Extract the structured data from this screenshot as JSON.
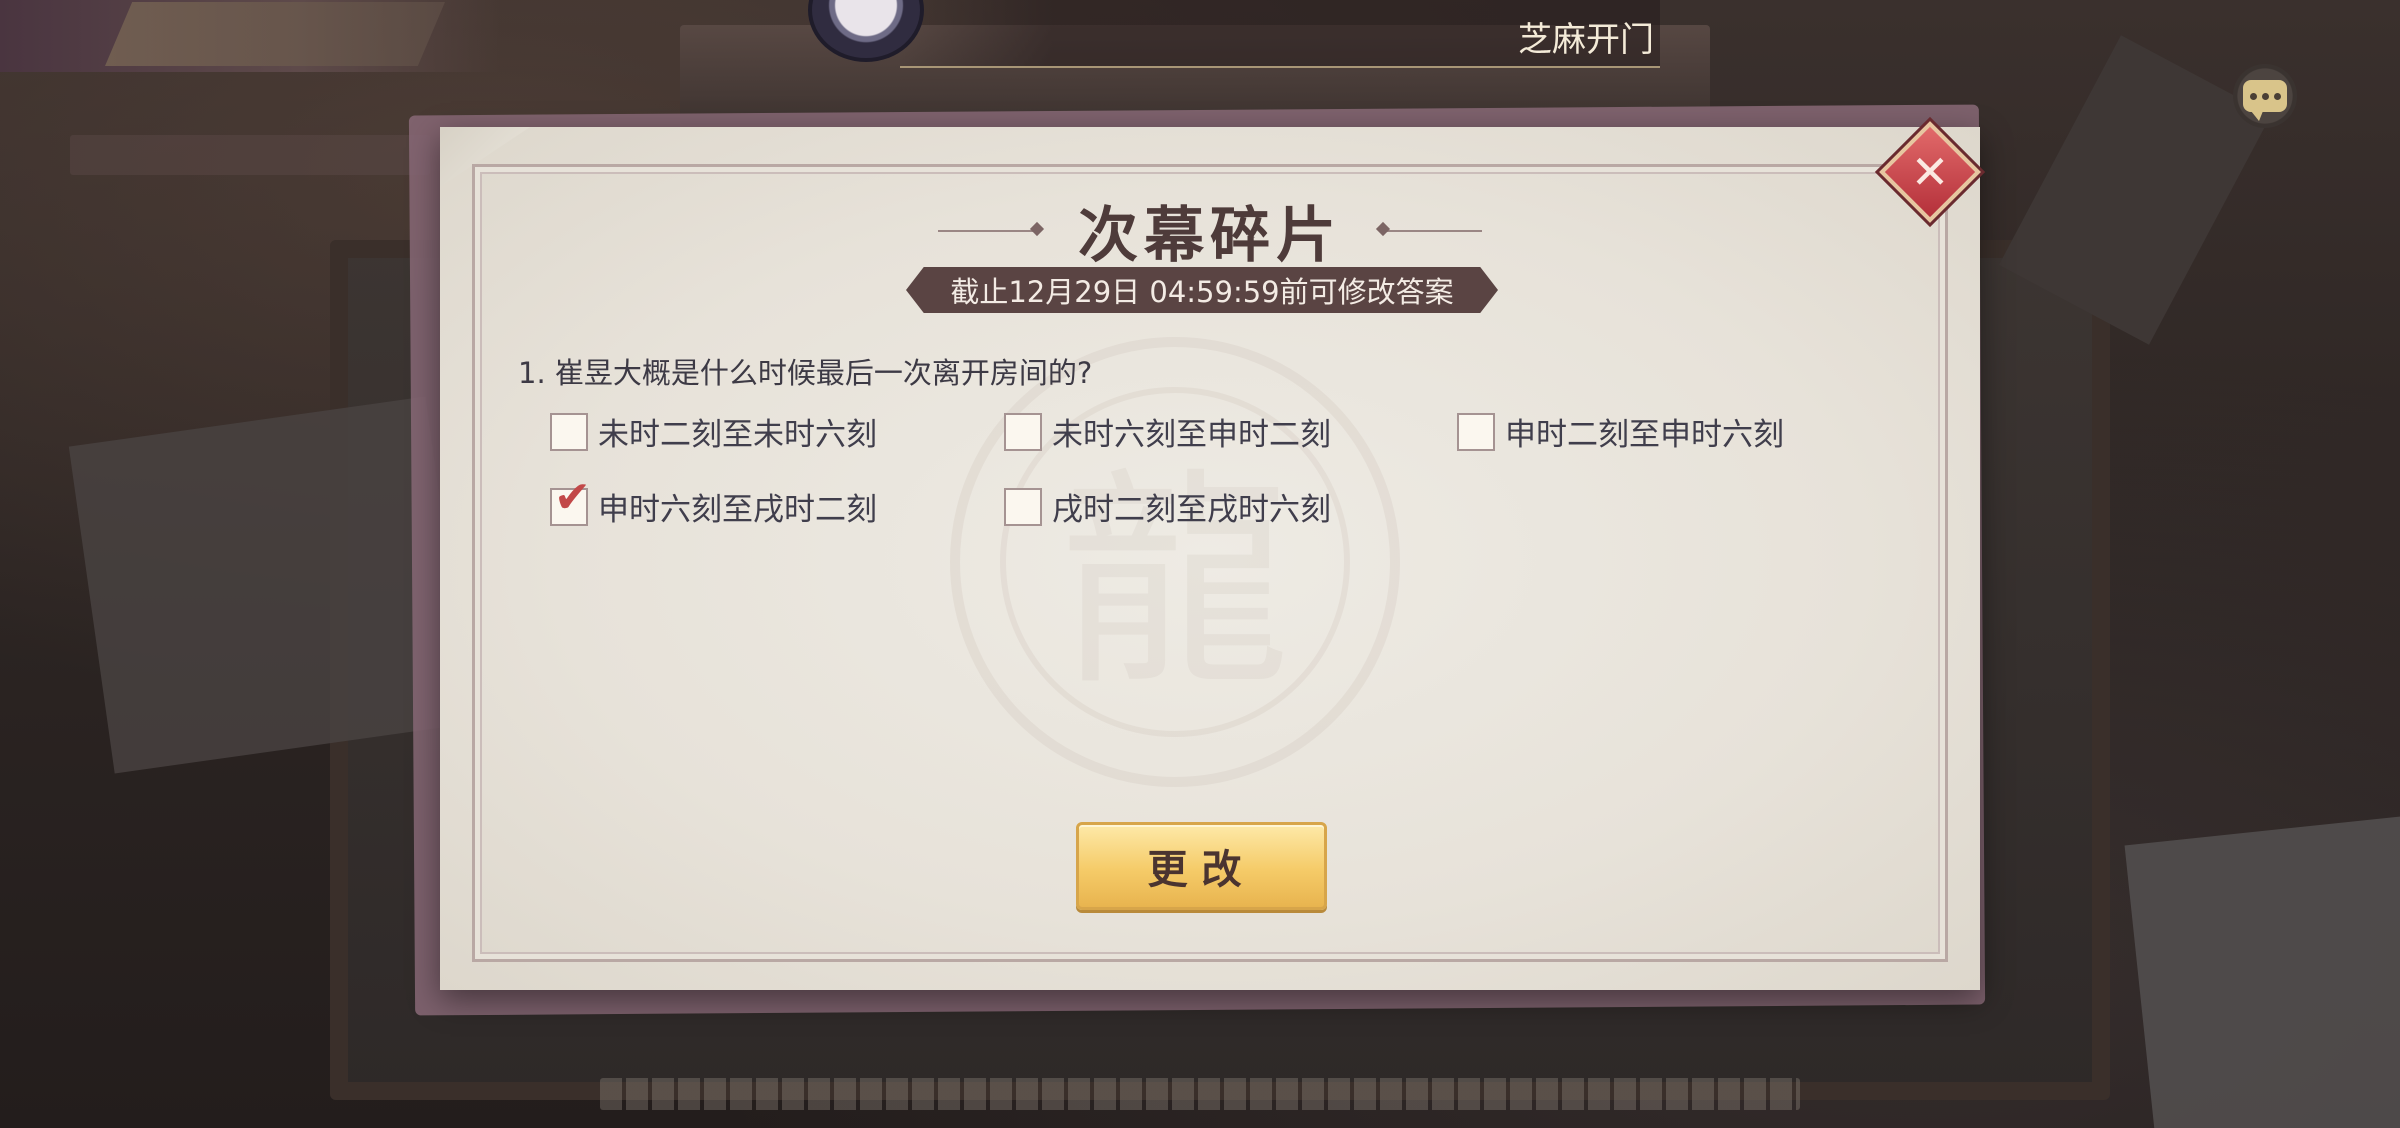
{
  "top_bar": {
    "status_text": "芝麻开门"
  },
  "dialog": {
    "title": "次幕碎片",
    "deadline": "截止12月29日 04:59:59前可修改答案",
    "question": "1. 崔昱大概是什么时候最后一次离开房间的?",
    "options": [
      {
        "label": "未时二刻至未时六刻",
        "checked": false
      },
      {
        "label": "未时六刻至申时二刻",
        "checked": false
      },
      {
        "label": "申时二刻至申时六刻",
        "checked": false
      },
      {
        "label": "申时六刻至戌时二刻",
        "checked": true
      },
      {
        "label": "戌时二刻至戌时六刻",
        "checked": false
      }
    ],
    "check_glyph": "✔",
    "modify_button": "更改",
    "close_glyph": "✕"
  },
  "icons": {
    "close": "close-icon",
    "chat": "chat-icon",
    "checkmark": "checkmark-icon"
  },
  "colors": {
    "title": "#4e3b3a",
    "deadline_bg": "#5a4443",
    "button_gold": "#f5cb68",
    "close_red": "#b4303a",
    "check_red": "#c24848"
  }
}
